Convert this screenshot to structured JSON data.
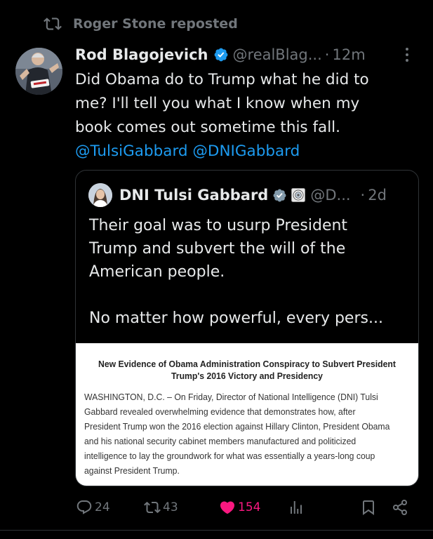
{
  "repost": {
    "text": "Roger Stone reposted"
  },
  "tweet": {
    "author_name": "Rod Blagojevich",
    "handle": "@realBlag...",
    "separator": "·",
    "time": "12m",
    "text_lines": [
      "Did Obama do to Trump what he did to",
      "me? I'll tell you what I know when my",
      "book comes out sometime this fall."
    ],
    "mentions": [
      "@TulsiGabbard",
      "@DNIGabbard"
    ]
  },
  "quote": {
    "author_name": "DNI Tulsi Gabbard",
    "handle": "@D...",
    "separator": "·",
    "time": "2d",
    "paragraph1": [
      "Their goal was to usurp President",
      "Trump and subvert the will of the",
      "American people."
    ],
    "paragraph2": "No matter how powerful, every pers...",
    "card": {
      "title_lines": [
        "New Evidence of Obama Administration Conspiracy to Subvert President",
        "Trump's 2016 Victory and Presidency"
      ],
      "body_lines": [
        "WASHINGTON, D.C. – On Friday, Director of National Intelligence (DNI) Tulsi",
        "Gabbard revealed overwhelming evidence that demonstrates how, after",
        "President Trump won the 2016 election against Hillary Clinton, President Obama",
        "and his national security cabinet members manufactured and politicized",
        "intelligence to lay the groundwork for what was essentially a years-long coup",
        "against President Trump."
      ]
    }
  },
  "actions": {
    "replies": "24",
    "reposts": "43",
    "likes": "154"
  },
  "colors": {
    "background": "#000000",
    "text": "#e7e9ea",
    "muted": "#71767b",
    "accent": "#1d9bf0",
    "like": "#f91880",
    "border": "#2f3336"
  }
}
